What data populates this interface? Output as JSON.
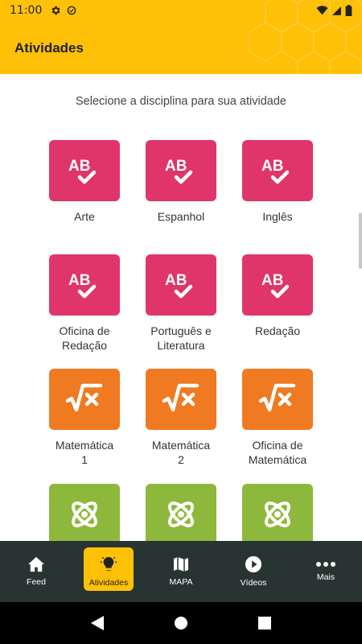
{
  "status_bar": {
    "time": "11:00"
  },
  "app_bar": {
    "title": "Atividades"
  },
  "content": {
    "subtitle": "Selecione a disciplina para sua atividade",
    "subjects": [
      {
        "label": "Arte",
        "category": "languages",
        "icon": "ab-check-icon",
        "color": "#E0356B"
      },
      {
        "label": "Espanhol",
        "category": "languages",
        "icon": "ab-check-icon",
        "color": "#E0356B"
      },
      {
        "label": "Inglês",
        "category": "languages",
        "icon": "ab-check-icon",
        "color": "#E0356B"
      },
      {
        "label": "Oficina de\nRedação",
        "category": "languages",
        "icon": "ab-check-icon",
        "color": "#E0356B"
      },
      {
        "label": "Português e\nLiteratura",
        "category": "languages",
        "icon": "ab-check-icon",
        "color": "#E0356B"
      },
      {
        "label": "Redação",
        "category": "languages",
        "icon": "ab-check-icon",
        "color": "#E0356B"
      },
      {
        "label": "Matemática\n1",
        "category": "math",
        "icon": "sqrt-x-icon",
        "color": "#EF7A22"
      },
      {
        "label": "Matemática\n2",
        "category": "math",
        "icon": "sqrt-x-icon",
        "color": "#EF7A22"
      },
      {
        "label": "Oficina de\nMatemática",
        "category": "math",
        "icon": "sqrt-x-icon",
        "color": "#EF7A22"
      },
      {
        "label": "",
        "category": "science",
        "icon": "atom-icon",
        "color": "#8DB83B"
      },
      {
        "label": "",
        "category": "science",
        "icon": "atom-icon",
        "color": "#8DB83B"
      },
      {
        "label": "",
        "category": "science",
        "icon": "atom-icon",
        "color": "#8DB83B"
      }
    ]
  },
  "bottom_nav": {
    "items": [
      {
        "label": "Feed",
        "icon": "home-icon"
      },
      {
        "label": "Atividades",
        "icon": "lightbulb-icon",
        "active": true
      },
      {
        "label": "MAPA",
        "icon": "map-icon"
      },
      {
        "label": "Vídeos",
        "icon": "play-circle-icon"
      },
      {
        "label": "Mais",
        "icon": "more-dots-icon"
      }
    ]
  },
  "colors": {
    "accent": "#FFC107",
    "languages": "#E0356B",
    "math": "#EF7A22",
    "science": "#8DB83B",
    "nav_bg": "#273432"
  }
}
